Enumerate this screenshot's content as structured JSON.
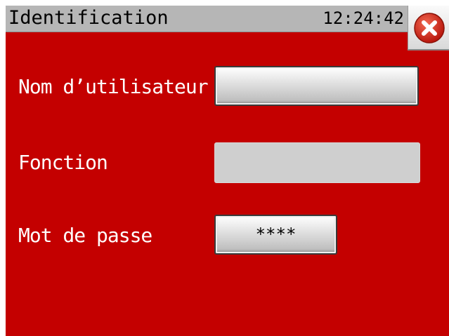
{
  "window": {
    "title": "Identification",
    "clock": "12:24:42"
  },
  "close_button": {
    "icon": "close-icon"
  },
  "form": {
    "username": {
      "label": "Nom d’utilisateur",
      "value": ""
    },
    "function": {
      "label": "Fonction",
      "value": ""
    },
    "password": {
      "label": "Mot de passe",
      "value": "****"
    }
  },
  "colors": {
    "background": "#c40000",
    "titlebar": "#b6b6b6",
    "close_icon": "#d42a1c"
  }
}
